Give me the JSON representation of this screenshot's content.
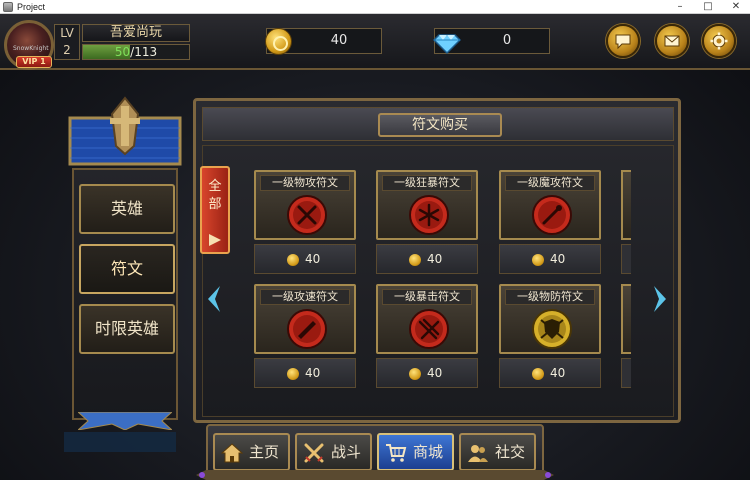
{
  "window": {
    "title": "Project",
    "controls": {
      "minimize": "–",
      "maximize": "□",
      "close": "✕"
    }
  },
  "player": {
    "avatar_caption": "SnowKnight",
    "vip_label": "VIP 1",
    "level_label": "LV",
    "level": "2",
    "name": "吾爱尚玩",
    "xp_current": "50",
    "xp_max": "113",
    "xp_fraction": 0.44
  },
  "currency": {
    "gold": "40",
    "diamonds": "0"
  },
  "hud_buttons": [
    {
      "icon": "chat-icon"
    },
    {
      "icon": "mail-icon"
    },
    {
      "icon": "gear-icon"
    }
  ],
  "side_tabs": [
    {
      "label": "英雄",
      "active": false
    },
    {
      "label": "符文",
      "active": true
    },
    {
      "label": "时限英雄",
      "active": false
    }
  ],
  "shop": {
    "title": "符文购买",
    "filter_tab": {
      "line1": "全",
      "line2": "部"
    },
    "items": [
      {
        "name": "一级物攻符文",
        "price": "40",
        "icon": "crossed-swords-red-rune-icon"
      },
      {
        "name": "一级狂暴符文",
        "price": "40",
        "icon": "crossed-blades-red-rune-icon"
      },
      {
        "name": "一级魔攻符文",
        "price": "40",
        "icon": "staff-red-rune-icon"
      },
      {
        "name": "一级攻速符文",
        "price": "40",
        "icon": "blade-red-rune-icon"
      },
      {
        "name": "一级暴击符文",
        "price": "40",
        "icon": "triple-blades-red-rune-icon"
      },
      {
        "name": "一级物防符文",
        "price": "40",
        "icon": "shield-gold-rune-icon"
      }
    ]
  },
  "bottom_nav": [
    {
      "label": "主页",
      "icon": "house-icon",
      "active": false
    },
    {
      "label": "战斗",
      "icon": "crossed-swords-icon",
      "active": false
    },
    {
      "label": "商城",
      "icon": "cart-icon",
      "active": true
    },
    {
      "label": "社交",
      "icon": "people-icon",
      "active": false
    }
  ],
  "colors": {
    "accent_gold": "#a58a4e",
    "active_blue": "#3f76d4",
    "rune_red": "#c42a1c",
    "filter_red": "#d8452c"
  }
}
